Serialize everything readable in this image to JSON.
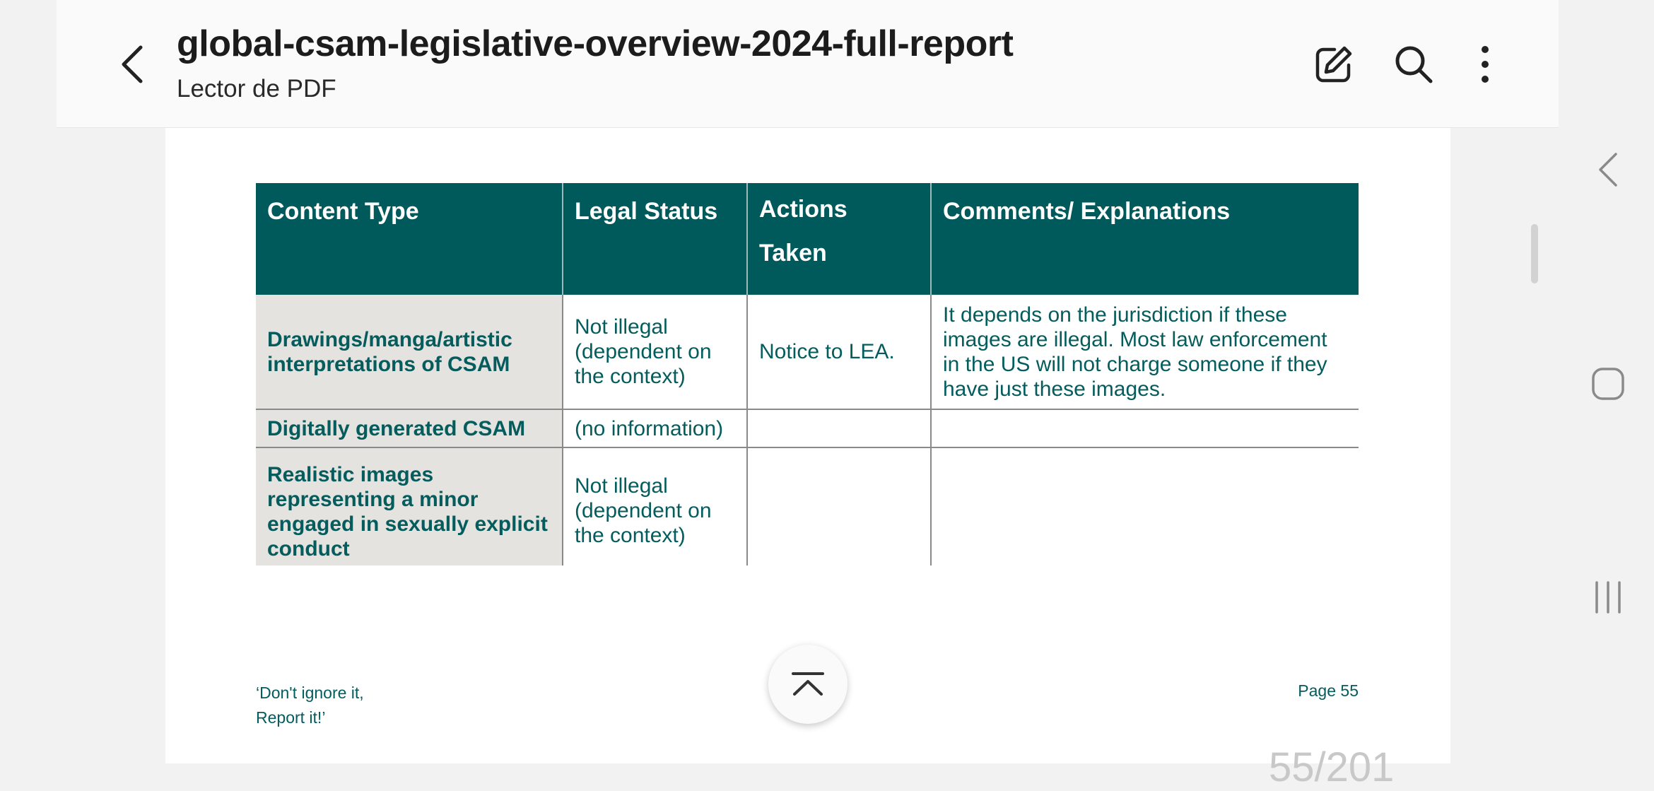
{
  "appbar": {
    "title": "global-csam-legislative-overview-2024-full-report",
    "subtitle": "Lector de PDF",
    "icons": {
      "back": "back-arrow-icon",
      "edit": "edit-icon",
      "search": "search-icon",
      "more": "more-vert-icon"
    }
  },
  "table": {
    "headers": [
      "Content Type",
      "Legal Status",
      "Actions Taken",
      "Comments/ Explanations"
    ],
    "rows": [
      {
        "content_type": "Drawings/manga/artistic interpretations of CSAM",
        "legal_status": "Not illegal (dependent on the context)",
        "actions": "Notice to LEA.",
        "comments": "It depends on the jurisdiction if these images are illegal. Most law enforcement in the US will not charge someone if they have just these images."
      },
      {
        "content_type": "Digitally generated CSAM",
        "legal_status": "(no information)",
        "actions": "",
        "comments": ""
      },
      {
        "content_type": "Realistic images representing a minor engaged in sexually explicit conduct",
        "legal_status": "Not illegal (dependent on the context)",
        "actions": "",
        "comments": ""
      }
    ]
  },
  "footer": {
    "left_line1": "‘Don't ignore it,",
    "left_line2": "Report it!’",
    "right": "Page 55"
  },
  "page_indicator": "55/201",
  "colors": {
    "header_bg": "#005a5c",
    "text_teal": "#045c5d",
    "first_col_bg": "#e4e3df"
  }
}
